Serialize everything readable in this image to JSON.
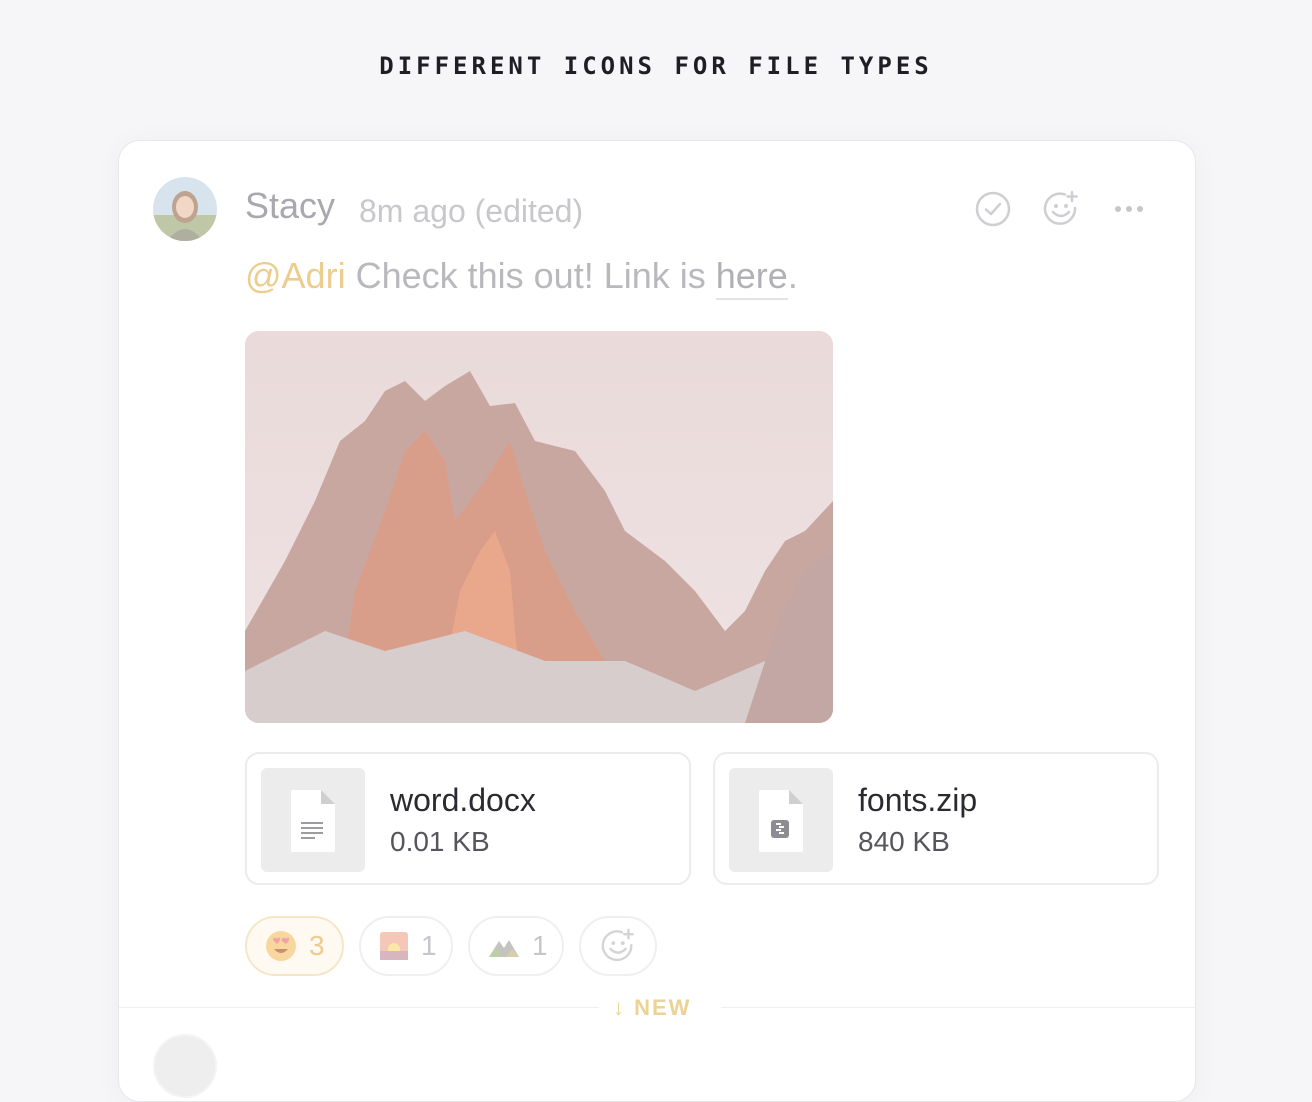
{
  "heading": "DIFFERENT ICONS FOR FILE TYPES",
  "message": {
    "author": "Stacy",
    "meta": "8m ago (edited)",
    "mention": "@Adri",
    "text": " Check this out! Link is ",
    "link": "here",
    "suffix": "."
  },
  "actions": [
    "check-circle-icon",
    "add-reaction-icon",
    "more-icon"
  ],
  "files": [
    {
      "name": "word.docx",
      "size": "0.01 KB",
      "icon": "document-icon"
    },
    {
      "name": "fonts.zip",
      "size": "840 KB",
      "icon": "zip-archive-icon"
    }
  ],
  "reactions": [
    {
      "emoji": "heart-eyes",
      "count": "3",
      "active": true
    },
    {
      "emoji": "sunset",
      "count": "1",
      "active": false
    },
    {
      "emoji": "mountain",
      "count": "1",
      "active": false
    }
  ],
  "new_label": "↓ NEW",
  "colors": {
    "accent": "#eccd8e",
    "muted_text": "#b8b8bd",
    "file_name": "#2a2a30"
  }
}
